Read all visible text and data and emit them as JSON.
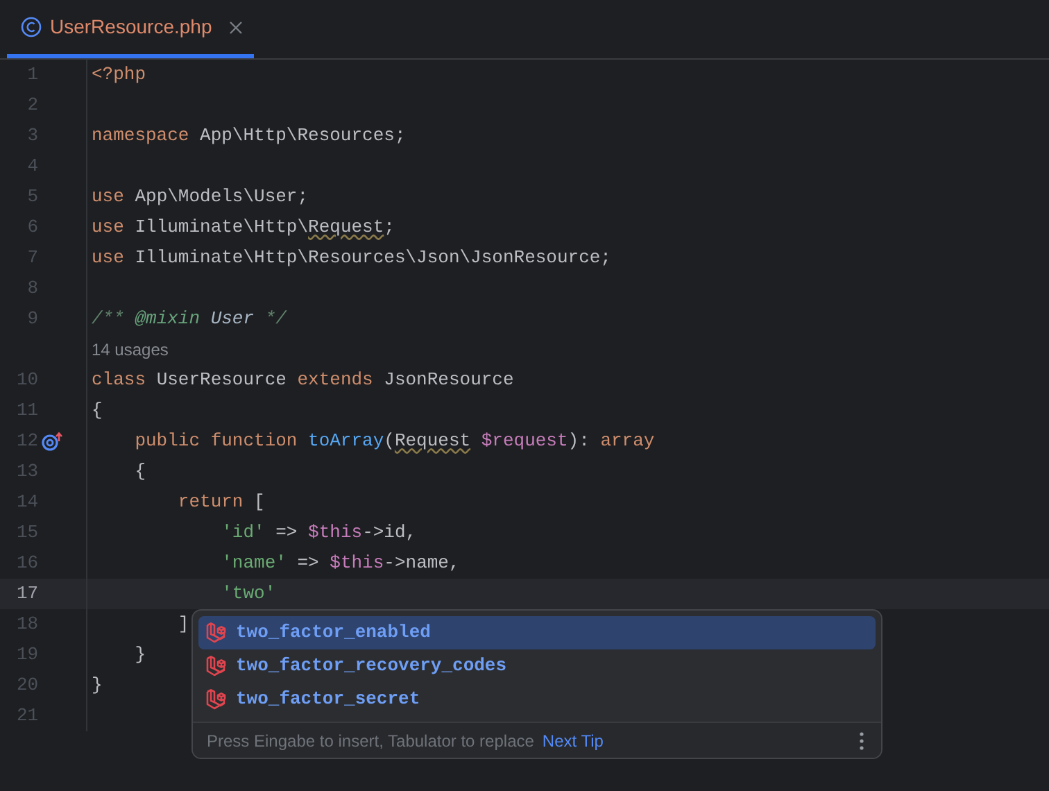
{
  "tab": {
    "title": "UserResource.php",
    "selected": true
  },
  "lines": [
    {
      "number": "1",
      "tokens": [
        {
          "kind": "kw",
          "text": "<?php"
        }
      ]
    },
    {
      "number": "2"
    },
    {
      "number": "3",
      "tokens": [
        {
          "kind": "kw",
          "text": "namespace "
        },
        {
          "kind": "plain",
          "text": "App\\Http\\Resources;"
        }
      ]
    },
    {
      "number": "4"
    },
    {
      "number": "5",
      "tokens": [
        {
          "kind": "kw",
          "text": "use "
        },
        {
          "kind": "plain",
          "text": "App\\Models\\User;"
        }
      ]
    },
    {
      "number": "6",
      "tokens": [
        {
          "kind": "kw",
          "text": "use "
        },
        {
          "kind": "plain",
          "text": "Illuminate\\Http\\"
        },
        {
          "kind": "plain",
          "text": "Request",
          "warning": true
        },
        {
          "kind": "plain",
          "text": ";"
        }
      ]
    },
    {
      "number": "7",
      "tokens": [
        {
          "kind": "kw",
          "text": "use "
        },
        {
          "kind": "plain",
          "text": "Illuminate\\Http\\Resources\\Json\\JsonResource;"
        }
      ]
    },
    {
      "number": "8"
    },
    {
      "number": "9",
      "tokens": [
        {
          "kind": "comment",
          "text": "/** "
        },
        {
          "kind": "doctag",
          "text": "@mixin"
        },
        {
          "kind": "commentref",
          "text": " User"
        },
        {
          "kind": "comment",
          "text": " */"
        }
      ]
    },
    {
      "kind": "inlay",
      "text": "14 usages"
    },
    {
      "number": "10",
      "tokens": [
        {
          "kind": "kw",
          "text": "class "
        },
        {
          "kind": "plain",
          "text": "UserResource "
        },
        {
          "kind": "kw",
          "text": "extends "
        },
        {
          "kind": "plain",
          "text": "JsonResource"
        }
      ]
    },
    {
      "number": "11",
      "tokens": [
        {
          "kind": "plain",
          "text": "{"
        }
      ]
    },
    {
      "number": "12",
      "marker": true,
      "tokens": [
        {
          "kind": "kw",
          "text": "    public function "
        },
        {
          "kind": "fn",
          "text": "toArray"
        },
        {
          "kind": "plain",
          "text": "("
        },
        {
          "kind": "plain",
          "text": "Request",
          "warning": true
        },
        {
          "kind": "var",
          "text": " $request"
        },
        {
          "kind": "plain",
          "text": "): "
        },
        {
          "kind": "kw",
          "text": "array"
        }
      ]
    },
    {
      "number": "13",
      "tokens": [
        {
          "kind": "plain",
          "text": "    {"
        }
      ]
    },
    {
      "number": "14",
      "tokens": [
        {
          "kind": "kw",
          "text": "        return "
        },
        {
          "kind": "plain",
          "text": "["
        }
      ]
    },
    {
      "number": "15",
      "tokens": [
        {
          "kind": "str",
          "text": "            'id'"
        },
        {
          "kind": "plain",
          "text": " => "
        },
        {
          "kind": "var",
          "text": "$this"
        },
        {
          "kind": "plain",
          "text": "->id,"
        }
      ]
    },
    {
      "number": "16",
      "tokens": [
        {
          "kind": "str",
          "text": "            'name'"
        },
        {
          "kind": "plain",
          "text": " => "
        },
        {
          "kind": "var",
          "text": "$this"
        },
        {
          "kind": "plain",
          "text": "->name,"
        }
      ]
    },
    {
      "number": "17",
      "current": true,
      "tokens": [
        {
          "kind": "str",
          "text": "            'two'"
        }
      ]
    },
    {
      "number": "18",
      "tokens": [
        {
          "kind": "plain",
          "text": "        ]"
        }
      ]
    },
    {
      "number": "19",
      "tokens": [
        {
          "kind": "plain",
          "text": "    }"
        }
      ]
    },
    {
      "number": "20",
      "tokens": [
        {
          "kind": "plain",
          "text": "}"
        }
      ]
    },
    {
      "number": "21"
    }
  ],
  "completion": {
    "items": [
      {
        "text": "two_factor_enabled",
        "selected": true
      },
      {
        "text": "two_factor_recovery_codes",
        "selected": false
      },
      {
        "text": "two_factor_secret",
        "selected": false
      }
    ],
    "hint": "Press Eingabe to insert, Tabulator to replace",
    "link": "Next Tip"
  }
}
